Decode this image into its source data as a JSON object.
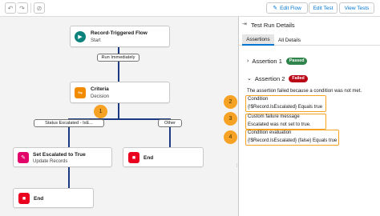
{
  "toolbar": {
    "undo_icon": "undo-icon",
    "redo_icon": "redo-icon",
    "disable_icon": "circle-slash-icon",
    "edit_flow_label": "Edit Flow",
    "edit_test_label": "Edit Test",
    "view_tests_label": "View Tests"
  },
  "canvas": {
    "start_node": {
      "title": "Record-Triggered Flow",
      "subtitle": "Start",
      "color": "#0b827c"
    },
    "run_pill": "Run Immediately",
    "decision_node": {
      "title": "Criteria",
      "subtitle": "Decision",
      "color": "#f28b00"
    },
    "branch_left": "Status Escalated - IsE...",
    "branch_right": "Other",
    "update_node": {
      "title": "Set Escalated to True",
      "subtitle": "Update Records",
      "color": "#e3066a"
    },
    "end_label_right": "End",
    "end_label_bottom": "End",
    "end_color": "#ea001e",
    "callout_1": "1",
    "connector_color": "#1b3a82"
  },
  "panel": {
    "title": "Test Run Details",
    "tabs": [
      "Assertions",
      "All Details"
    ],
    "assertion_1": {
      "label": "Assertion 1",
      "status": "Passed",
      "color": "#2e844a"
    },
    "assertion_2": {
      "label": "Assertion 2",
      "status": "Failed",
      "color": "#ba0517"
    },
    "failure_message": "The assertion failed because a condition was not met.",
    "condition_label": "Condition",
    "condition_value": "{!$Record.IsEscalated} Equals true",
    "custom_label": "Custom failure message",
    "custom_value": "Escalated was not set to true.",
    "evaluation_label": "Condition evaluation",
    "evaluation_value": "{!$Record.IsEscalated} (false) Equals true",
    "callouts": [
      "2",
      "3",
      "4"
    ],
    "highlight_color": "#f6a224"
  }
}
